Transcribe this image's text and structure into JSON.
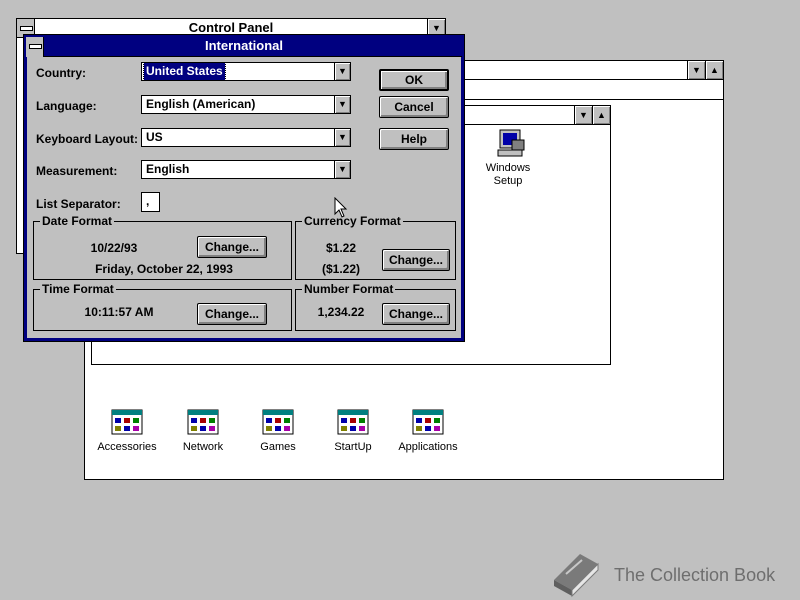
{
  "control_panel": {
    "title": "Control Panel"
  },
  "international": {
    "title": "International",
    "country_label": "Country:",
    "country_value": "United States",
    "language_label": "Language:",
    "language_value": "English (American)",
    "keyboard_label": "Keyboard Layout:",
    "keyboard_value": "US",
    "measurement_label": "Measurement:",
    "measurement_value": "English",
    "list_separator_label": "List Separator:",
    "list_separator_value": ",",
    "ok": "OK",
    "cancel": "Cancel",
    "help": "Help",
    "date_format": {
      "title": "Date Format",
      "short": "10/22/93",
      "long": "Friday, October 22, 1993",
      "change": "Change..."
    },
    "currency_format": {
      "title": "Currency Format",
      "positive": "$1.22",
      "negative": "($1.22)",
      "change": "Change..."
    },
    "time_format": {
      "title": "Time Format",
      "value": "10:11:57 AM",
      "change": "Change..."
    },
    "number_format": {
      "title": "Number Format",
      "value": "1,234.22",
      "change": "Change..."
    }
  },
  "program_manager": {
    "groups": [
      "Accessories",
      "Network",
      "Games",
      "StartUp",
      "Applications"
    ],
    "inner_icon": [
      "Windows",
      "Setup"
    ]
  },
  "watermark": {
    "text": "The Collection Book"
  }
}
